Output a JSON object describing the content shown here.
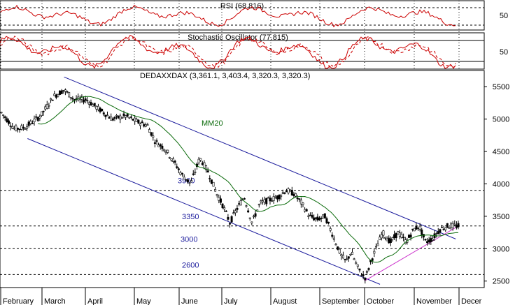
{
  "chart_data": [
    {
      "type": "line",
      "title": "RSI (68.816)",
      "ylim": [
        0,
        100
      ],
      "yticks": [
        50
      ],
      "reference_levels": [
        30,
        70
      ],
      "color": "#cc0000"
    },
    {
      "type": "line",
      "title": "Stochastic Oscillator (77.815)",
      "ylim": [
        0,
        100
      ],
      "yticks": [
        50
      ],
      "reference_levels": [
        20,
        80
      ],
      "series": [
        {
          "color": "#cc0000",
          "style": "solid"
        },
        {
          "color": "#cc0000",
          "style": "dashed"
        }
      ]
    },
    {
      "type": "candlestick",
      "title": "DEDAXXDAX (3,361.1, 3,403.4, 3,320.3, 3,320.3)",
      "ylim": [
        2400,
        5750
      ],
      "yticks": [
        2500,
        3000,
        3500,
        4000,
        4500,
        5000,
        5500
      ],
      "x_months": [
        "February",
        "March",
        "April",
        "May",
        "June",
        "July",
        "August",
        "September",
        "October",
        "November",
        "Decer"
      ],
      "grid": false,
      "price_anchors": [
        {
          "x": 0,
          "y": 5100
        },
        {
          "x": 10,
          "y": 4850
        },
        {
          "x": 18,
          "y": 4870
        },
        {
          "x": 30,
          "y": 5050
        },
        {
          "x": 40,
          "y": 5350
        },
        {
          "x": 48,
          "y": 5450
        },
        {
          "x": 56,
          "y": 5300
        },
        {
          "x": 65,
          "y": 5300
        },
        {
          "x": 75,
          "y": 5150
        },
        {
          "x": 85,
          "y": 5000
        },
        {
          "x": 95,
          "y": 5050
        },
        {
          "x": 105,
          "y": 4950
        },
        {
          "x": 112,
          "y": 4900
        },
        {
          "x": 118,
          "y": 4650
        },
        {
          "x": 125,
          "y": 4550
        },
        {
          "x": 132,
          "y": 4350
        },
        {
          "x": 138,
          "y": 4150
        },
        {
          "x": 145,
          "y": 4000
        },
        {
          "x": 152,
          "y": 4400
        },
        {
          "x": 158,
          "y": 4200
        },
        {
          "x": 165,
          "y": 3850
        },
        {
          "x": 170,
          "y": 3650
        },
        {
          "x": 175,
          "y": 3400
        },
        {
          "x": 180,
          "y": 3600
        },
        {
          "x": 186,
          "y": 3800
        },
        {
          "x": 192,
          "y": 3400
        },
        {
          "x": 198,
          "y": 3700
        },
        {
          "x": 205,
          "y": 3750
        },
        {
          "x": 212,
          "y": 3800
        },
        {
          "x": 218,
          "y": 3900
        },
        {
          "x": 224,
          "y": 3850
        },
        {
          "x": 230,
          "y": 3700
        },
        {
          "x": 236,
          "y": 3500
        },
        {
          "x": 242,
          "y": 3450
        },
        {
          "x": 248,
          "y": 3500
        },
        {
          "x": 252,
          "y": 3300
        },
        {
          "x": 256,
          "y": 3100
        },
        {
          "x": 260,
          "y": 2900
        },
        {
          "x": 264,
          "y": 2800
        },
        {
          "x": 268,
          "y": 2950
        },
        {
          "x": 272,
          "y": 2750
        },
        {
          "x": 276,
          "y": 2600
        },
        {
          "x": 279,
          "y": 2550
        },
        {
          "x": 283,
          "y": 2800
        },
        {
          "x": 287,
          "y": 3000
        },
        {
          "x": 292,
          "y": 3250
        },
        {
          "x": 298,
          "y": 3100
        },
        {
          "x": 304,
          "y": 3250
        },
        {
          "x": 310,
          "y": 3100
        },
        {
          "x": 316,
          "y": 3300
        },
        {
          "x": 320,
          "y": 3350
        },
        {
          "x": 325,
          "y": 3100
        },
        {
          "x": 330,
          "y": 3150
        },
        {
          "x": 336,
          "y": 3300
        },
        {
          "x": 342,
          "y": 3350
        }
      ],
      "moving_average": {
        "name": "MM20",
        "window": 20,
        "color": "#0a6a0a"
      },
      "horizontal_levels": [
        {
          "label": "3900",
          "value": 3900
        },
        {
          "label": "3350",
          "value": 3350
        },
        {
          "label": "3000",
          "value": 3000
        },
        {
          "label": "2600",
          "value": 2600
        }
      ],
      "trend_lines": [
        {
          "color": "#1a1a9c",
          "from": {
            "x": 20,
            "y": 4700
          },
          "to": {
            "x": 290,
            "y": 2450
          }
        },
        {
          "color": "#1a1a9c",
          "from": {
            "x": 48,
            "y": 5650
          },
          "to": {
            "x": 348,
            "y": 3150
          }
        },
        {
          "color": "#cc33cc",
          "from": {
            "x": 278,
            "y": 2500
          },
          "to": {
            "x": 350,
            "y": 3350
          }
        }
      ]
    }
  ]
}
